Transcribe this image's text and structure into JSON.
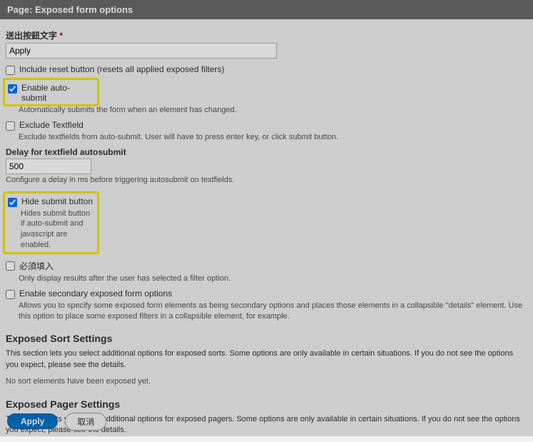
{
  "title": "Page: Exposed form options",
  "submit_button_text": {
    "label": "送出按鈕文字",
    "required_marker": "*",
    "value": "Apply"
  },
  "include_reset": {
    "label": "Include reset button (resets all applied exposed filters)",
    "checked": false
  },
  "enable_autosubmit": {
    "label": "Enable auto-submit",
    "checked": true,
    "description": "Automatically submits the form when an element has changed."
  },
  "exclude_textfield": {
    "label": "Exclude Textfield",
    "checked": false,
    "description": "Exclude textfields from auto-submit. User will have to press enter key, or click submit button."
  },
  "delay": {
    "label": "Delay for textfield autosubmit",
    "value": "500",
    "description": "Configure a delay in ms before triggering autosubmit on textfields."
  },
  "hide_submit": {
    "label": "Hide submit button",
    "checked": true,
    "description": "Hides submit button if auto-submit and javascript are enabled."
  },
  "required_input": {
    "label": "必須填入",
    "checked": false,
    "description": "Only display results after the user has selected a filter option."
  },
  "enable_secondary": {
    "label": "Enable secondary exposed form options",
    "checked": false,
    "description": "Allows you to specify some exposed form elements as being secondary options and places those elements in a collapsible \"details\" element. Use this option to place some exposed filters in a collapsible element, for example."
  },
  "sort_settings": {
    "heading": "Exposed Sort Settings",
    "text": "This section lets you select additional options for exposed sorts. Some options are only available in certain situations. If you do not see the options you expect, please see the details.",
    "empty": "No sort elements have been exposed yet."
  },
  "pager_settings": {
    "heading": "Exposed Pager Settings",
    "text": "This section lets you select additional options for exposed pagers. Some options are only available in certain situations. If you do not see the options you expect, please see the details."
  },
  "buttons": {
    "apply": "Apply",
    "cancel": "取消"
  }
}
